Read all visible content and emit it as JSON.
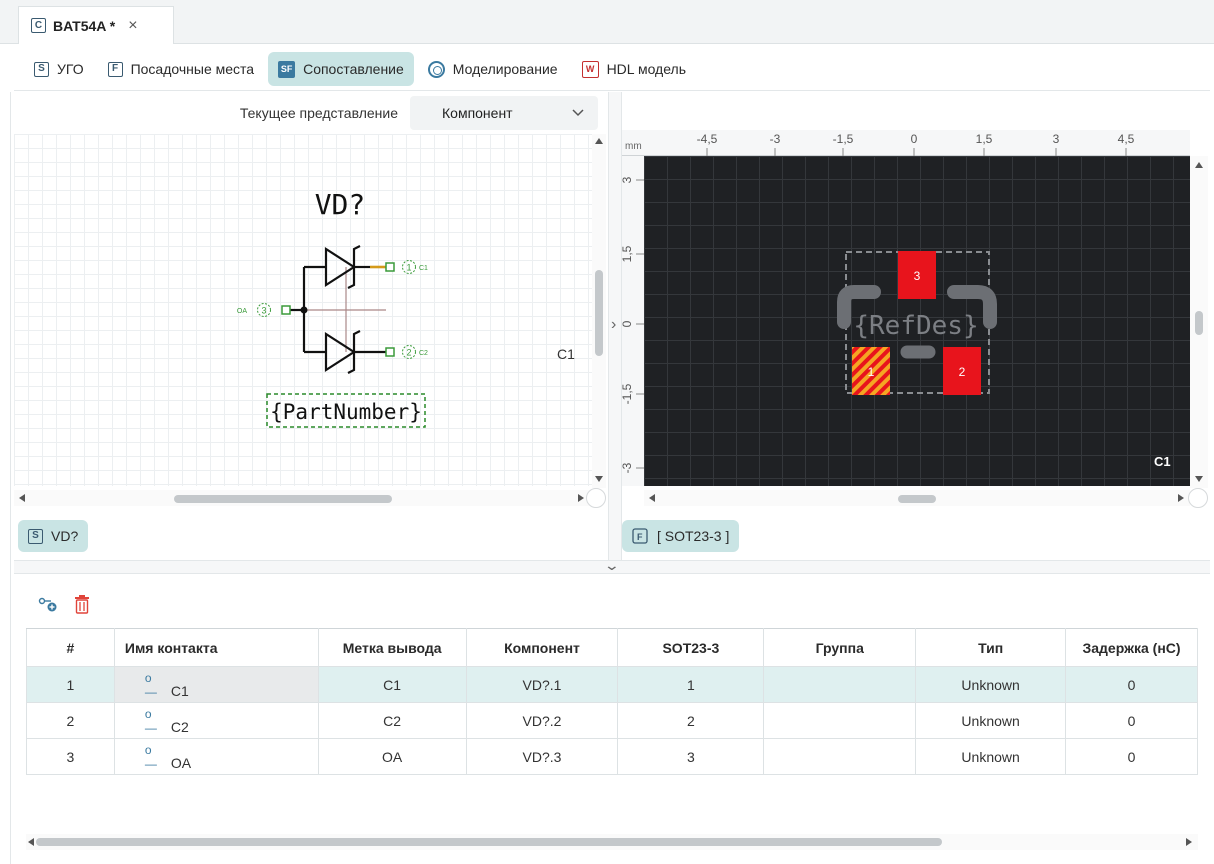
{
  "document_tab": {
    "icon_letter": "C",
    "title": "BAT54A *",
    "close_glyph": "×"
  },
  "view_tabs": [
    {
      "icon": "S",
      "label": "УГО"
    },
    {
      "icon": "F",
      "label": "Посадочные места"
    },
    {
      "icon": "SF",
      "label": "Сопоставление",
      "active": true
    },
    {
      "icon": "sim",
      "label": "Моделирование"
    },
    {
      "icon": "W",
      "label": "HDL модель"
    }
  ],
  "representation": {
    "label": "Текущее представление",
    "value": "Компонент"
  },
  "symbol": {
    "refdes": "VD?",
    "part_number": "{PartNumber}",
    "pins": [
      {
        "number": "1",
        "name": "C1"
      },
      {
        "number": "2",
        "name": "C2"
      },
      {
        "number": "3",
        "name": "OA"
      }
    ],
    "corner_label": "C1"
  },
  "footprint": {
    "units": "mm",
    "x_ticks": [
      "-4,5",
      "-3",
      "-1,5",
      "0",
      "1,5",
      "3",
      "4,5"
    ],
    "y_ticks": [
      "3",
      "1,5",
      "0",
      "-1,5",
      "-3"
    ],
    "refdes_text": "{RefDes}",
    "pads": [
      "1",
      "2",
      "3"
    ],
    "corner_label": "C1"
  },
  "left_chip": {
    "icon": "S",
    "label": "VD?"
  },
  "right_chip": {
    "icon": "F",
    "label": "[ SOT23-3 ]"
  },
  "table": {
    "headers": [
      "#",
      "Имя контакта",
      "Метка вывода",
      "Компонент",
      "SOT23-3",
      "Группа",
      "Тип",
      "Задержка (нС)"
    ],
    "rows": [
      {
        "num": "1",
        "name": "C1",
        "label": "C1",
        "component": "VD?.1",
        "pad": "1",
        "group": "",
        "type": "Unknown",
        "delay": "0"
      },
      {
        "num": "2",
        "name": "C2",
        "label": "C2",
        "component": "VD?.2",
        "pad": "2",
        "group": "",
        "type": "Unknown",
        "delay": "0"
      },
      {
        "num": "3",
        "name": "OA",
        "label": "OA",
        "component": "VD?.3",
        "pad": "3",
        "group": "",
        "type": "Unknown",
        "delay": "0"
      }
    ]
  },
  "colors": {
    "accent": "#c9e4e4",
    "selected_row": "#dff0f0",
    "pad_red": "#e8141c",
    "pcb_bg": "#1f2124",
    "pin_green": "#3a9a3a",
    "pin_orange": "#d49a1a"
  }
}
